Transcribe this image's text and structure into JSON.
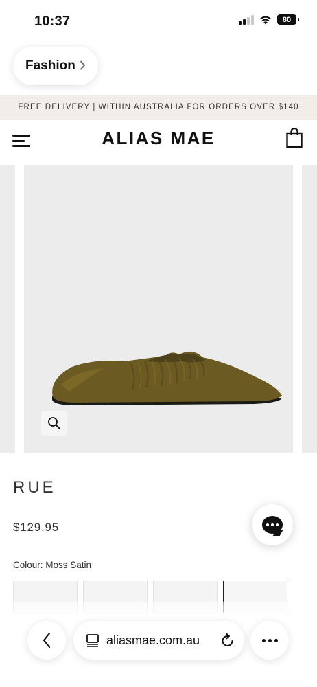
{
  "status_bar": {
    "time": "10:37",
    "battery": "80",
    "icons": [
      "signal-icon",
      "wifi-icon",
      "battery-icon"
    ]
  },
  "back_app": {
    "label": "Fashion"
  },
  "promo": {
    "text": "FREE DELIVERY | WITHIN AUSTRALIA FOR ORDERS OVER $140"
  },
  "header": {
    "logo": "ALIAS MAE",
    "icons": [
      "menu-icon",
      "shopping-bag-icon"
    ]
  },
  "product": {
    "title": "RUE",
    "price": "$129.95",
    "colour_label": "Colour: Moss Satin",
    "swatch_count": 4,
    "selected_swatch": 4
  },
  "gallery": {
    "icons": [
      "zoom-icon"
    ]
  },
  "chat": {
    "icon": "chat-icon"
  },
  "browser": {
    "url": "aliasmae.com.au",
    "icons": [
      "back-chevron-icon",
      "tabs-icon",
      "reload-icon",
      "more-icon"
    ]
  },
  "colors": {
    "promo_bg": "#f1eeea",
    "image_bg": "#ececec",
    "shoe": "#6f5d22",
    "text": "#111111"
  }
}
